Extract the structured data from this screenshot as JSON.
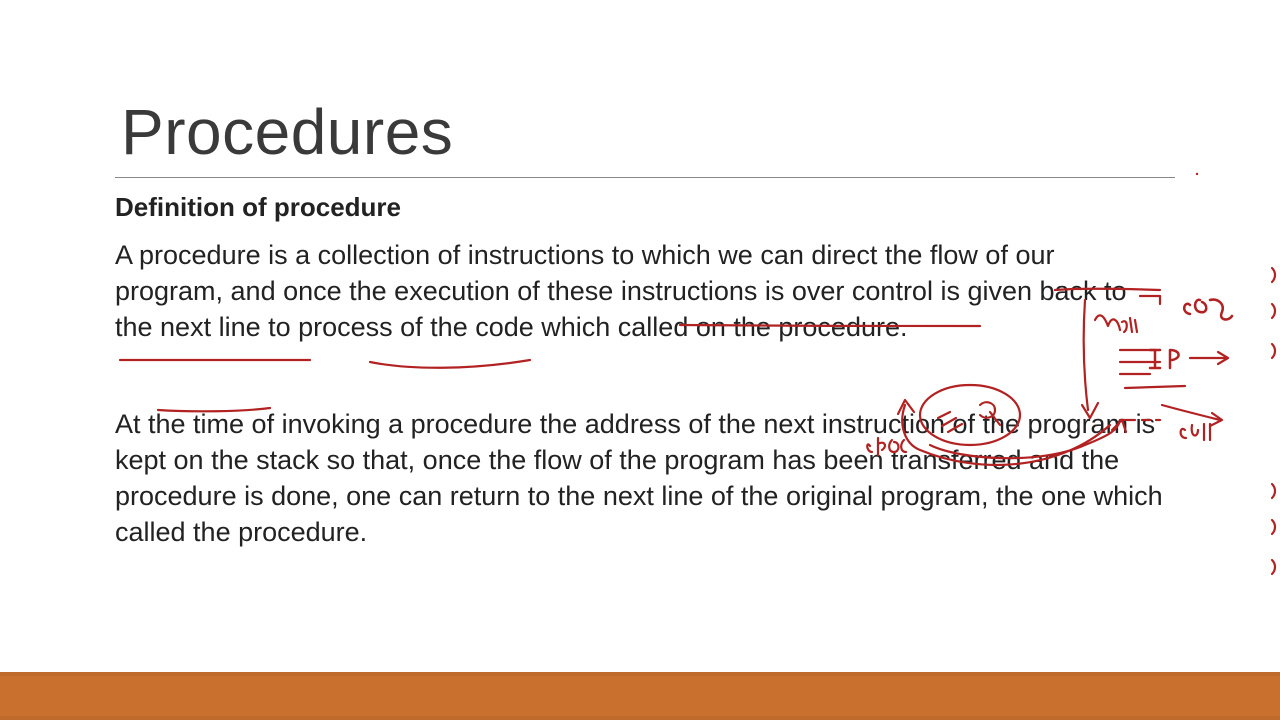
{
  "slide": {
    "title": "Procedures",
    "subheading": "Definition of procedure",
    "paragraph1": "A procedure is a collection of instructions to which we can direct the flow of our program, and once the execution of these instructions is over control is given back to the next line to process of the code which called on the procedure.",
    "paragraph2": "At the time of invoking a procedure the address of the next instruction of the program is kept on the stack so that, once the flow of the program has been transferred and the procedure is done, one can return to the next line of the original program, the one which called the procedure."
  },
  "annotations": {
    "ink_color": "#b22222",
    "labels": [
      "CS",
      "IP",
      "Main",
      "call",
      "proc"
    ]
  },
  "theme": {
    "accent": "#c06a2c"
  }
}
